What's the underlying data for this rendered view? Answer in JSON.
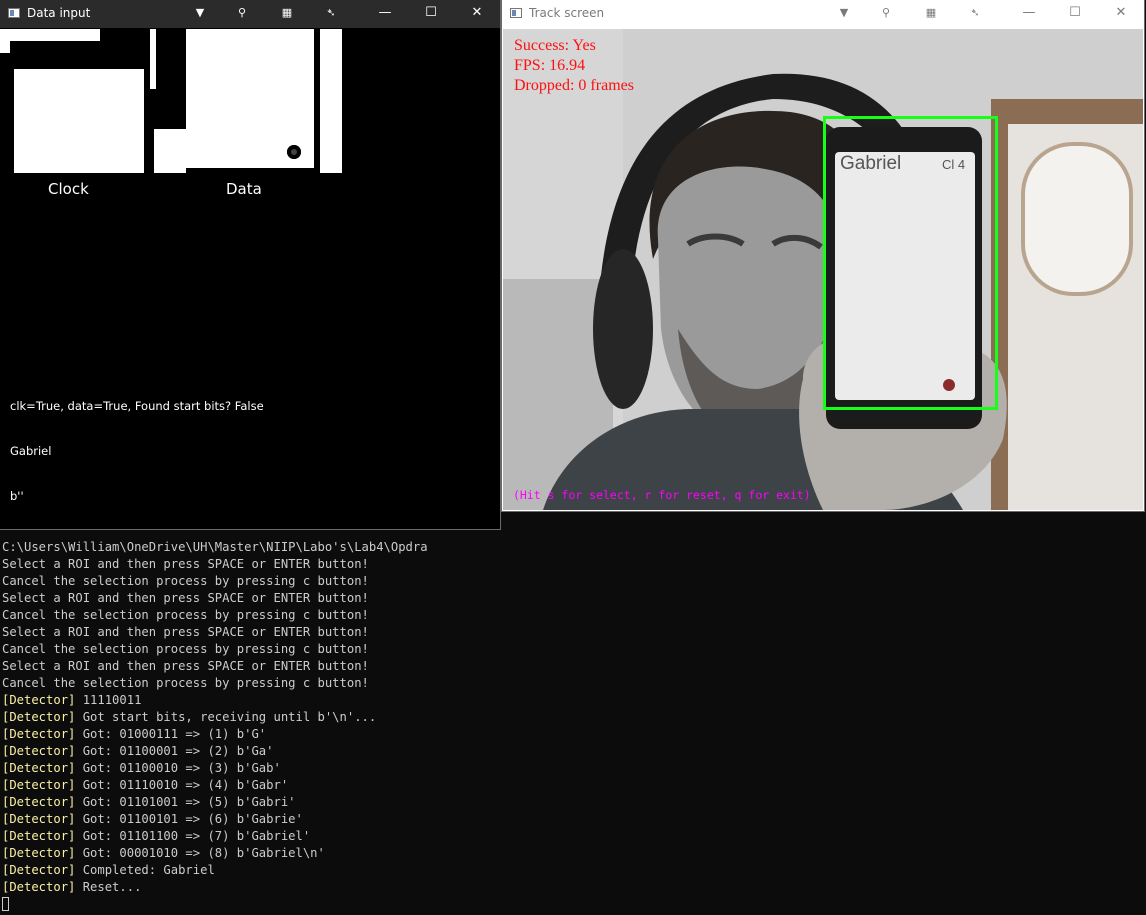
{
  "console": {
    "lines": [
      {
        "tag": "",
        "text": "C:\\Users\\William\\OneDrive\\UH\\Master\\NIIP\\Labo's\\Lab4\\Opdra"
      },
      {
        "tag": "",
        "text": "Select a ROI and then press SPACE or ENTER button!"
      },
      {
        "tag": "",
        "text": "Cancel the selection process by pressing c button!"
      },
      {
        "tag": "",
        "text": "Select a ROI and then press SPACE or ENTER button!"
      },
      {
        "tag": "",
        "text": "Cancel the selection process by pressing c button!"
      },
      {
        "tag": "",
        "text": "Select a ROI and then press SPACE or ENTER button!"
      },
      {
        "tag": "",
        "text": "Cancel the selection process by pressing c button!"
      },
      {
        "tag": "",
        "text": "Select a ROI and then press SPACE or ENTER button!"
      },
      {
        "tag": "",
        "text": "Cancel the selection process by pressing c button!"
      },
      {
        "tag": "[Detector]",
        "text": " 11110011"
      },
      {
        "tag": "[Detector]",
        "text": " Got start bits, receiving until b'\\n'..."
      },
      {
        "tag": "[Detector]",
        "text": " Got: 01000111 => (1) b'G'"
      },
      {
        "tag": "[Detector]",
        "text": " Got: 01100001 => (2) b'Ga'"
      },
      {
        "tag": "[Detector]",
        "text": " Got: 01100010 => (3) b'Gab'"
      },
      {
        "tag": "[Detector]",
        "text": " Got: 01110010 => (4) b'Gabr'"
      },
      {
        "tag": "[Detector]",
        "text": " Got: 01101001 => (5) b'Gabri'"
      },
      {
        "tag": "[Detector]",
        "text": " Got: 01100101 => (6) b'Gabrie'"
      },
      {
        "tag": "[Detector]",
        "text": " Got: 01101100 => (7) b'Gabriel'"
      },
      {
        "tag": "[Detector]",
        "text": " Got: 00001010 => (8) b'Gabriel\\n'"
      },
      {
        "tag": "[Detector]",
        "text": " Completed: Gabriel"
      },
      {
        "tag": "[Detector]",
        "text": " Reset..."
      }
    ],
    "colors": {
      "text": "#cccccc",
      "tag": "#f9f1a5",
      "background": "#0c0c0c"
    }
  },
  "data_window": {
    "title": "Data input",
    "labels": {
      "clock": "Clock",
      "data": "Data"
    },
    "info": [
      "clk=True, data=True, Found start bits? False",
      "Gabriel",
      "b''"
    ],
    "tools": [
      "pan-icon",
      "zoom-icon",
      "grid-icon",
      "pin-icon"
    ]
  },
  "track_window": {
    "title": "Track screen",
    "overlay": {
      "success": "Success: Yes",
      "fps": "FPS: 16.94",
      "dropped": "Dropped: 0 frames",
      "hint": "(Hit s for select, r for reset, q for exit)"
    },
    "phone": {
      "name": "Gabriel",
      "status": "Cl 4"
    },
    "colors": {
      "overlay_text": "#ff1010",
      "hint_text": "#ff00ff",
      "tracking_box": "#17ff17"
    }
  }
}
